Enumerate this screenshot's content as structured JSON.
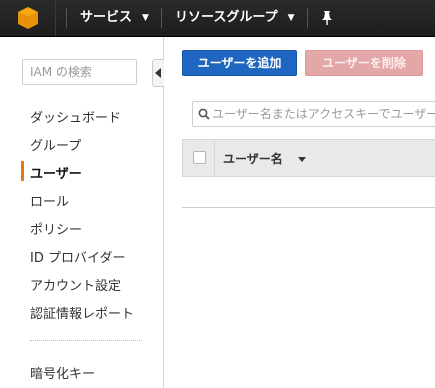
{
  "topbar": {
    "logo_icon": "aws-cube-icon",
    "services_label": "サービス",
    "resource_groups_label": "リソースグループ",
    "pin_icon": "pushpin-icon"
  },
  "sidebar": {
    "search_placeholder": "IAM の検索",
    "items": [
      {
        "label": "ダッシュボード"
      },
      {
        "label": "グループ"
      },
      {
        "label": "ユーザー"
      },
      {
        "label": "ロール"
      },
      {
        "label": "ポリシー"
      },
      {
        "label": "ID プロバイダー"
      },
      {
        "label": "アカウント設定"
      },
      {
        "label": "認証情報レポート"
      },
      {
        "label": "暗号化キー"
      }
    ],
    "active_item": "ユーザー",
    "accent_color": "#e47911"
  },
  "main": {
    "add_user_label": "ユーザーを追加",
    "delete_user_label": "ユーザーを削除",
    "filter_placeholder": "ユーザー名またはアクセスキーでユーザーをフィルタ",
    "table": {
      "columns": [
        "ユーザー名"
      ]
    },
    "primary_color": "#1f66c1"
  }
}
